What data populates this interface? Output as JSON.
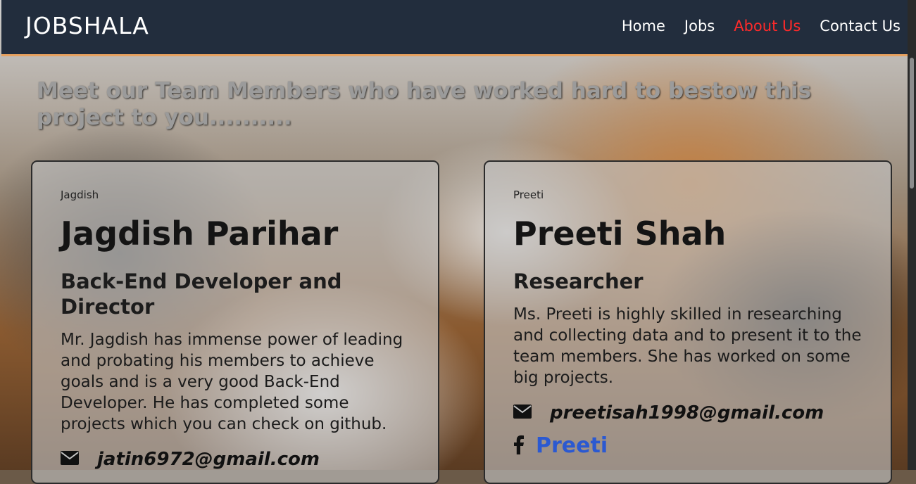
{
  "navbar": {
    "brand": "JOBSHALA",
    "links": [
      {
        "label": "Home"
      },
      {
        "label": "Jobs"
      },
      {
        "label": "About Us"
      },
      {
        "label": "Contact Us"
      }
    ],
    "active_color": "#ff2a2a",
    "background": "#222d3d",
    "accent": "#e7a15f"
  },
  "heading": "Meet our Team Members who have worked hard to bestow this project to you..........",
  "members": [
    {
      "tag": "Jagdish",
      "name": "Jagdish Parihar",
      "role": "Back-End Developer and Director",
      "description": "Mr. Jagdish has immense power of leading and probating his members to achieve goals and is a very good Back-End Developer. He has completed some projects which you can check on github.",
      "email": "jatin6972@gmail.com",
      "email_icon": "envelope-icon"
    },
    {
      "tag": "Preeti",
      "name": "Preeti Shah",
      "role": "Researcher",
      "description": "Ms. Preeti is highly skilled in researching and collecting data and to present it to the team members. She has worked on some big projects.",
      "email": "preetisah1998@gmail.com",
      "email_icon": "envelope-icon",
      "facebook": "Preeti",
      "facebook_icon": "facebook-icon",
      "link_color": "#2b59d1"
    }
  ]
}
